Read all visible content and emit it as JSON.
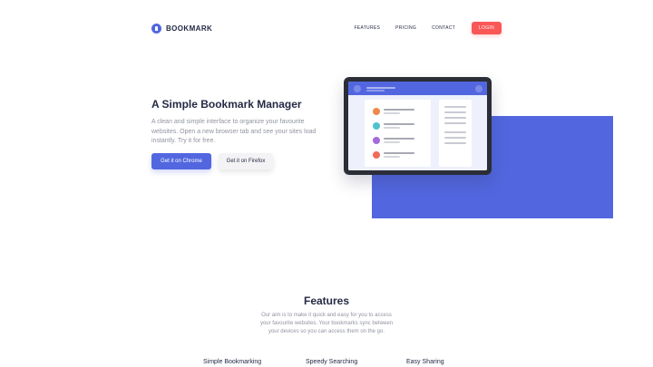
{
  "nav": {
    "brand": "BOOKMARK",
    "links": [
      "FEATURES",
      "PRICING",
      "CONTACT"
    ],
    "login": "LOGIN"
  },
  "hero": {
    "title": "A Simple Bookmark Manager",
    "description": "A clean and simple interface to organize your favourite websites. Open a new browser tab and see your sites load instantly. Try it for free.",
    "chrome_button": "Get it on Chrome",
    "firefox_button": "Get it on Firefox"
  },
  "features": {
    "title": "Features",
    "description": "Our aim is to make it quick and easy for you to access your favourite websites. Your bookmarks sync between your devices so you can access them on the go.",
    "tabs": [
      "Simple Bookmarking",
      "Speedy Searching",
      "Easy Sharing"
    ]
  },
  "colors": {
    "primary": "#5267df",
    "accent": "#fa5757",
    "text": "#242a45",
    "muted": "#9194a1"
  },
  "icons": {
    "brand": "bookmark-logo-icon"
  }
}
